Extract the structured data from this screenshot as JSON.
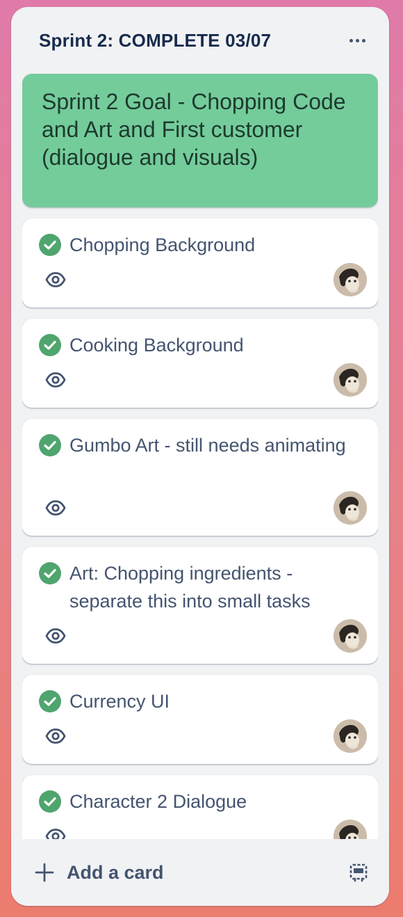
{
  "list": {
    "title": "Sprint 2: COMPLETE 03/07",
    "menu_icon": "ellipsis-icon"
  },
  "goal_card": {
    "text": "Sprint 2 Goal - Chopping Code and Art and First customer (dialogue and visuals)",
    "color": "#74cc9b"
  },
  "cards": [
    {
      "title": "Chopping Background",
      "status": "complete",
      "watching": true
    },
    {
      "title": "Cooking Background",
      "status": "complete",
      "watching": true
    },
    {
      "title": "Gumbo Art - still needs animating",
      "status": "complete",
      "watching": true
    },
    {
      "title": "Art: Chopping ingredients - separate this into small tasks",
      "status": "complete",
      "watching": true
    },
    {
      "title": "Currency UI",
      "status": "complete",
      "watching": true
    },
    {
      "title": "Character 2 Dialogue",
      "status": "complete",
      "watching": true
    }
  ],
  "footer": {
    "add_card_label": "Add a card",
    "add_icon": "plus-icon",
    "template_icon": "card-template-icon"
  },
  "colors": {
    "check": "#4fa56e",
    "list_bg": "#f1f2f4",
    "title_text": "#172b4d",
    "card_text": "#44546f"
  }
}
